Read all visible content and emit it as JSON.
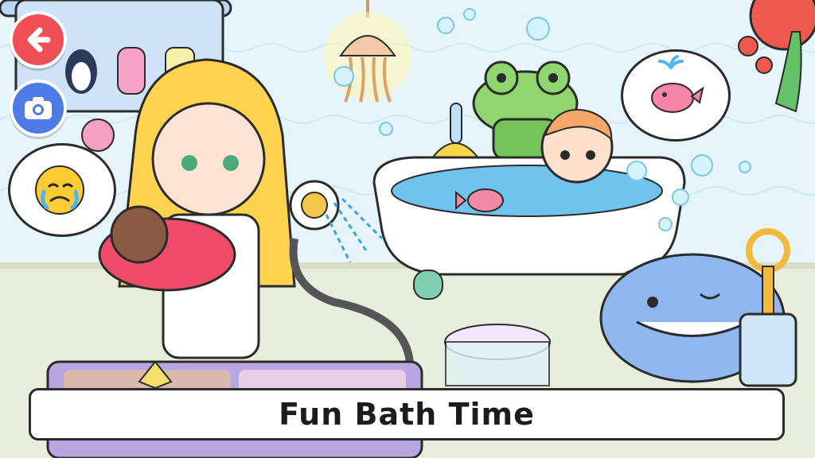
{
  "scene": {
    "name": "bathroom",
    "colors": {
      "wall": "#e6f4fb",
      "floor": "#e9eddc",
      "tub": "#ffffff",
      "water": "#6fc3ec",
      "back_button": "#f05055",
      "camera_button": "#4d7be8",
      "whale": "#8fb8f0",
      "frog": "#8fd66f"
    }
  },
  "controls": {
    "back_icon": "arrow-left-icon",
    "camera_icon": "camera-icon"
  },
  "bubbles": {
    "left_emoji": "crying-face-emoji",
    "right_icon": "pink-whale-fountain-icon"
  },
  "caption": {
    "text": "Fun Bath Time"
  }
}
